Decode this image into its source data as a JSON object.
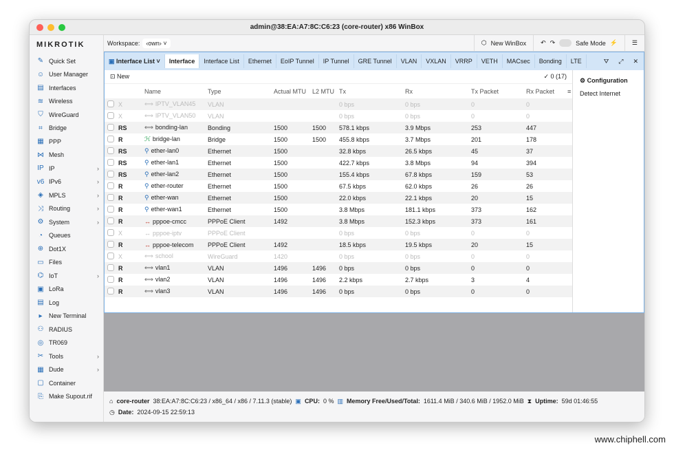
{
  "window_title": "admin@38:EA:A7:8C:C6:23 (core-router) x86 WinBox",
  "brand": "MIKROTIK",
  "sidebar": {
    "items": [
      {
        "label": "Quick Set",
        "icon": "wand-icon",
        "sub": false
      },
      {
        "label": "User Manager",
        "icon": "users-icon",
        "sub": false
      },
      {
        "label": "Interfaces",
        "icon": "interfaces-icon",
        "sub": false
      },
      {
        "label": "Wireless",
        "icon": "wireless-icon",
        "sub": false
      },
      {
        "label": "WireGuard",
        "icon": "shield-icon",
        "sub": false
      },
      {
        "label": "Bridge",
        "icon": "bridge-icon",
        "sub": false
      },
      {
        "label": "PPP",
        "icon": "ppp-icon",
        "sub": false
      },
      {
        "label": "Mesh",
        "icon": "mesh-icon",
        "sub": false
      },
      {
        "label": "IP",
        "icon": "ip-icon",
        "sub": true
      },
      {
        "label": "IPv6",
        "icon": "ipv6-icon",
        "sub": true
      },
      {
        "label": "MPLS",
        "icon": "mpls-icon",
        "sub": true
      },
      {
        "label": "Routing",
        "icon": "routing-icon",
        "sub": true
      },
      {
        "label": "System",
        "icon": "gear-icon",
        "sub": true
      },
      {
        "label": "Queues",
        "icon": "queues-icon",
        "sub": false
      },
      {
        "label": "Dot1X",
        "icon": "dot1x-icon",
        "sub": false
      },
      {
        "label": "Files",
        "icon": "folder-icon",
        "sub": false
      },
      {
        "label": "IoT",
        "icon": "iot-icon",
        "sub": true
      },
      {
        "label": "LoRa",
        "icon": "lora-icon",
        "sub": false
      },
      {
        "label": "Log",
        "icon": "log-icon",
        "sub": false
      },
      {
        "label": "New Terminal",
        "icon": "terminal-icon",
        "sub": false
      },
      {
        "label": "RADIUS",
        "icon": "radius-icon",
        "sub": false
      },
      {
        "label": "TR069",
        "icon": "tr069-icon",
        "sub": false
      },
      {
        "label": "Tools",
        "icon": "tools-icon",
        "sub": true
      },
      {
        "label": "Dude",
        "icon": "dude-icon",
        "sub": true
      },
      {
        "label": "Container",
        "icon": "container-icon",
        "sub": false
      },
      {
        "label": "Make Supout.rif",
        "icon": "supout-icon",
        "sub": false
      }
    ]
  },
  "toolbar": {
    "workspace_label": "Workspace:",
    "workspace_value": "‹own›",
    "new_winbox": "New WinBox",
    "safe_mode": "Safe Mode"
  },
  "iface_window": {
    "title": "Interface List",
    "tabs": [
      "Interface",
      "Interface List",
      "Ethernet",
      "EoIP Tunnel",
      "IP Tunnel",
      "GRE Tunnel",
      "VLAN",
      "VXLAN",
      "VRRP",
      "VETH",
      "MACsec",
      "Bonding",
      "LTE"
    ],
    "active_tab": "Interface",
    "new_label": "New",
    "count": "0 (17)",
    "columns": [
      "Name",
      "Type",
      "Actual MTU",
      "L2 MTU",
      "Tx",
      "Rx",
      "Tx Packet",
      "Rx Packet"
    ],
    "rows": [
      [
        "X",
        "IPTV_VLAN45",
        "VLAN",
        "",
        "",
        "0 bps",
        "0 bps",
        "0",
        "0",
        "vlan",
        true
      ],
      [
        "X",
        "IPTV_VLAN50",
        "VLAN",
        "",
        "",
        "0 bps",
        "0 bps",
        "0",
        "0",
        "vlan",
        true
      ],
      [
        "RS",
        "bonding-lan",
        "Bonding",
        "1500",
        "1500",
        "578.1 kbps",
        "3.9 Mbps",
        "253",
        "447",
        "vlan",
        false
      ],
      [
        "R",
        "bridge-lan",
        "Bridge",
        "1500",
        "1500",
        "455.8 kbps",
        "3.7 Mbps",
        "201",
        "178",
        "bridge",
        false
      ],
      [
        "RS",
        "ether-lan0",
        "Ethernet",
        "1500",
        "",
        "32.8 kbps",
        "26.5 kbps",
        "45",
        "37",
        "ether",
        false
      ],
      [
        "RS",
        "ether-lan1",
        "Ethernet",
        "1500",
        "",
        "422.7 kbps",
        "3.8 Mbps",
        "94",
        "394",
        "ether",
        false
      ],
      [
        "RS",
        "ether-lan2",
        "Ethernet",
        "1500",
        "",
        "155.4 kbps",
        "67.8 kbps",
        "159",
        "53",
        "ether",
        false
      ],
      [
        "R",
        "ether-router",
        "Ethernet",
        "1500",
        "",
        "67.5 kbps",
        "62.0 kbps",
        "26",
        "26",
        "ether",
        false
      ],
      [
        "R",
        "ether-wan",
        "Ethernet",
        "1500",
        "",
        "22.0 kbps",
        "22.1 kbps",
        "20",
        "15",
        "ether",
        false
      ],
      [
        "R",
        "ether-wan1",
        "Ethernet",
        "1500",
        "",
        "3.8 Mbps",
        "181.1 kbps",
        "373",
        "162",
        "ether",
        false
      ],
      [
        "R",
        "pppoe-cmcc",
        "PPPoE Client",
        "1492",
        "",
        "3.8 Mbps",
        "152.3 kbps",
        "373",
        "161",
        "ppp",
        false
      ],
      [
        "X",
        "pppoe-iptv",
        "PPPoE Client",
        "",
        "",
        "0 bps",
        "0 bps",
        "0",
        "0",
        "ppp",
        true
      ],
      [
        "R",
        "pppoe-telecom",
        "PPPoE Client",
        "1492",
        "",
        "18.5 kbps",
        "19.5 kbps",
        "20",
        "15",
        "ppp",
        false
      ],
      [
        "X",
        "school",
        "WireGuard",
        "1420",
        "",
        "0 bps",
        "0 bps",
        "0",
        "0",
        "vlan",
        true
      ],
      [
        "R",
        "vlan1",
        "VLAN",
        "1496",
        "1496",
        "0 bps",
        "0 bps",
        "0",
        "0",
        "vlan",
        false
      ],
      [
        "R",
        "vlan2",
        "VLAN",
        "1496",
        "1496",
        "2.2 kbps",
        "2.7 kbps",
        "3",
        "4",
        "vlan",
        false
      ],
      [
        "R",
        "vlan3",
        "VLAN",
        "1496",
        "1496",
        "0 bps",
        "0 bps",
        "0",
        "0",
        "vlan",
        false
      ]
    ],
    "side_panel": {
      "title": "Configuration",
      "items": [
        "Detect Internet"
      ]
    }
  },
  "status": {
    "identity": "core-router",
    "info": "38:EA:A7:8C:C6:23 / x86_64 / x86 / 7.11.3 (stable)",
    "cpu_label": "CPU:",
    "cpu": "0 %",
    "mem_label": "Memory Free/Used/Total:",
    "mem": "1611.4 MiB / 340.6 MiB / 1952.0 MiB",
    "uptime_label": "Uptime:",
    "uptime": "59d 01:46:55",
    "date_label": "Date:",
    "date": "2024-09-15 22:59:13"
  },
  "watermark": "www.chiphell.com",
  "colors": {
    "accent": "#2a6fb8",
    "tab_bar": "#d3e5f7",
    "ppp": "#c0392b",
    "bridge": "#1e9e4a"
  }
}
